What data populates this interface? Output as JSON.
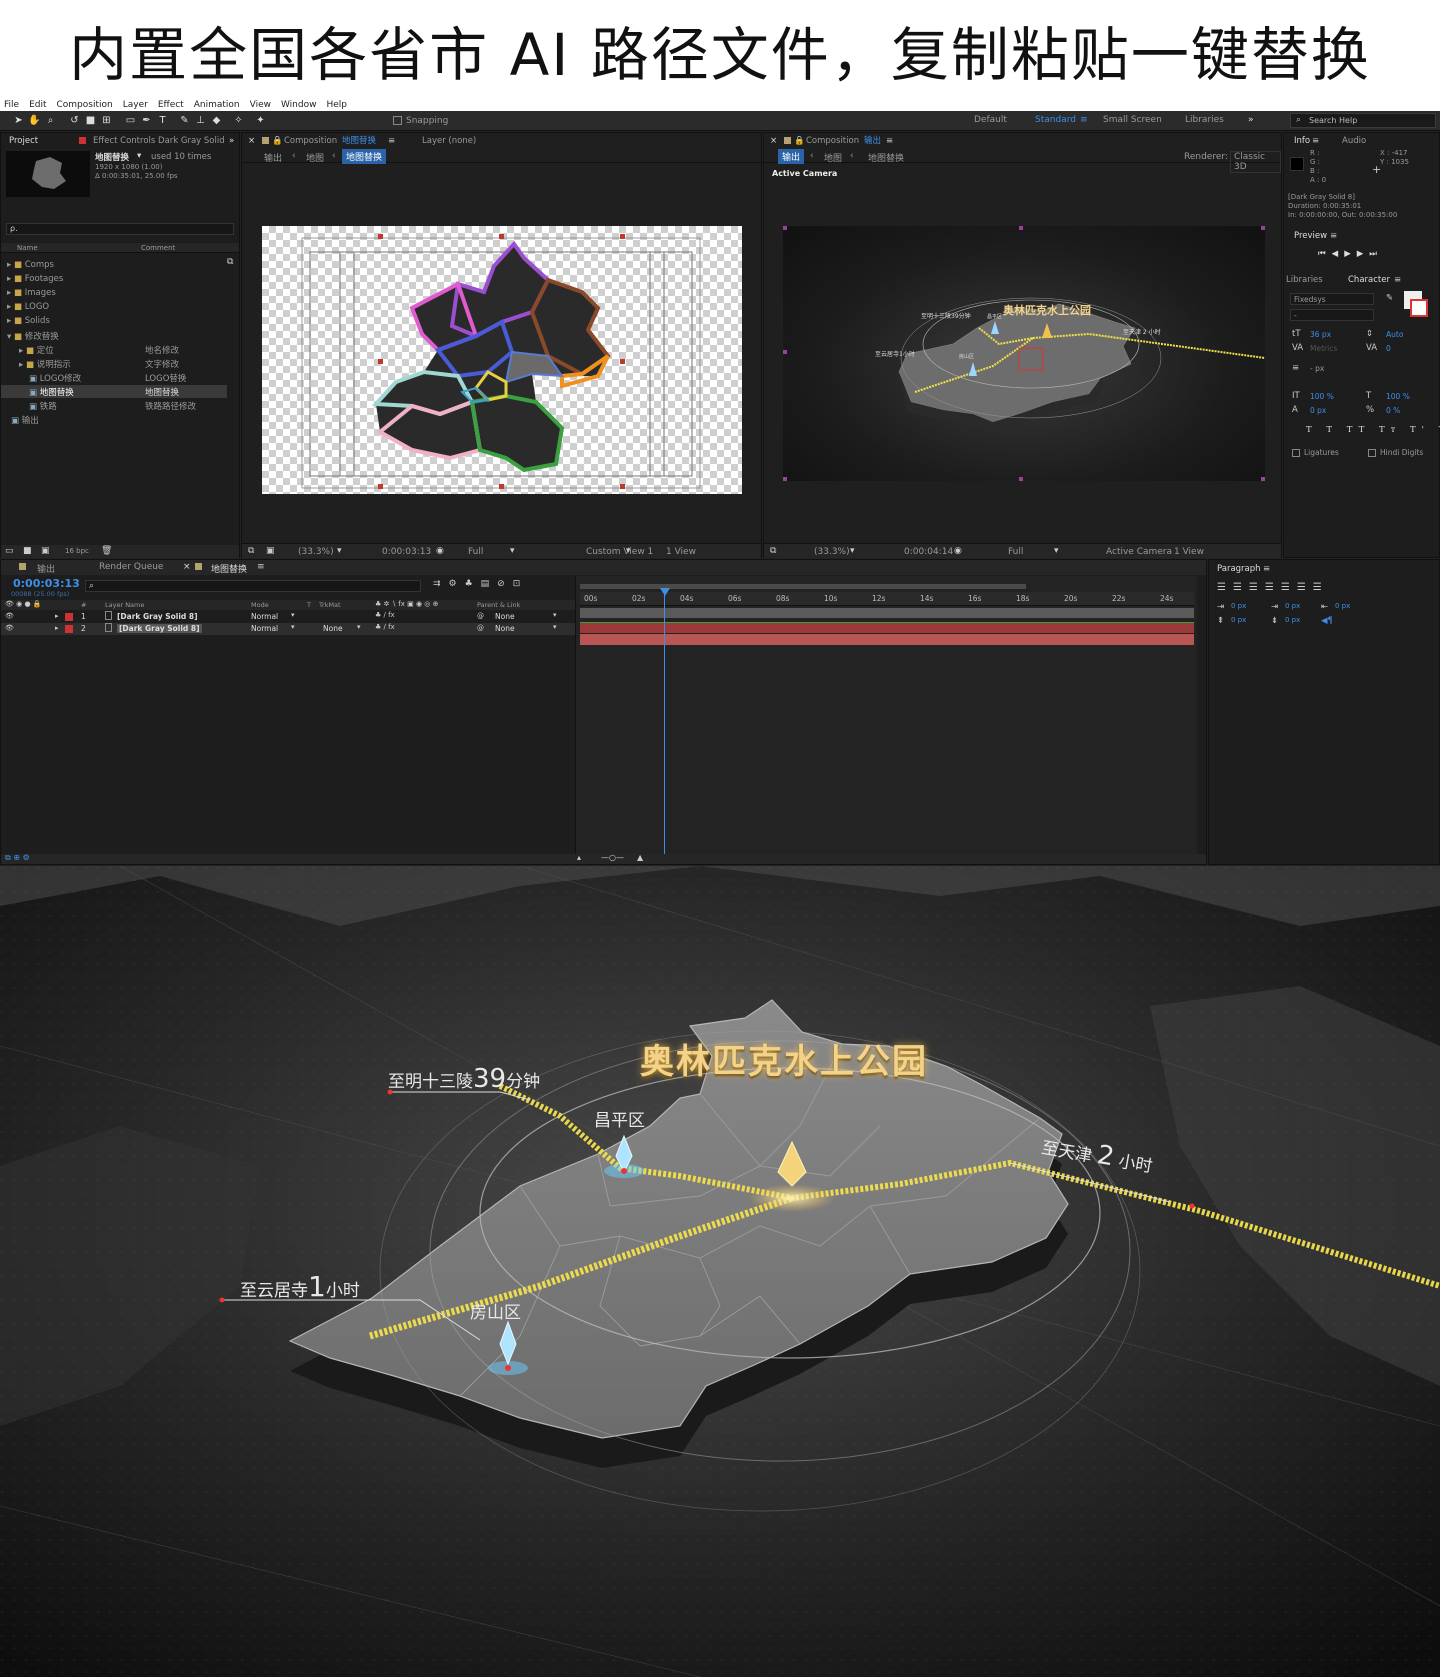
{
  "headline": "内置全国各省市 AI 路径文件，复制粘贴一键替换",
  "menu": [
    "File",
    "Edit",
    "Composition",
    "Layer",
    "Effect",
    "Animation",
    "View",
    "Window",
    "Help"
  ],
  "toolbar": {
    "snapping": "Snapping",
    "workspaces": [
      "Default",
      "Standard",
      "Small Screen",
      "Libraries"
    ],
    "active_workspace": "Standard",
    "search": "Search Help"
  },
  "project": {
    "tab": "Project",
    "effect_tab": "Effect Controls Dark Gray Solid",
    "item_name": "地图替换",
    "used": "used 10 times",
    "item_size": "1920 x 1080 (1.00)",
    "item_duration": "Δ 0:00:35:01, 25.00 fps",
    "search": "ρ.",
    "col_name": "Name",
    "col_comment": "Comment",
    "items": [
      {
        "name": "Comps",
        "comment": ""
      },
      {
        "name": "Footages",
        "comment": ""
      },
      {
        "name": "Images",
        "comment": ""
      },
      {
        "name": "LOGO",
        "comment": ""
      },
      {
        "name": "Solids",
        "comment": ""
      },
      {
        "name": "修改替换",
        "comment": ""
      },
      {
        "name": "定位",
        "comment": "地名修改"
      },
      {
        "name": "说明指示",
        "comment": "文字修改"
      },
      {
        "name": "LOGO修改",
        "comment": "LOGO替换"
      },
      {
        "name": "地图替换",
        "comment": "地图替换"
      },
      {
        "name": "铁路",
        "comment": "铁路路径修改"
      },
      {
        "name": "输出",
        "comment": ""
      }
    ],
    "bpc": "16 bpc"
  },
  "comp1": {
    "tab": "Composition",
    "tab_name": "地图替换",
    "layer": "Layer (none)",
    "crumbs": [
      "输出",
      "地图",
      "地图替换"
    ],
    "zoom": "(33.3%)",
    "time": "0:00:03:13",
    "quality": "Full",
    "view": "Custom View 1",
    "views": "1 View"
  },
  "comp2": {
    "tab": "Composition",
    "tab_name": "输出",
    "crumbs": [
      "输出",
      "地图",
      "地图替换"
    ],
    "renderer_label": "Renderer:",
    "renderer": "Classic 3D",
    "camera": "Active Camera",
    "zoom": "(33.3%)",
    "time": "0:00:04:14",
    "quality": "Full",
    "view": "Active Camera",
    "views": "1 View",
    "mini_title": "奥林匹克水上公园",
    "mini_labels": [
      "至明十三陵39分钟",
      "至云居寺1小时",
      "至天津 2 小时",
      "昌平区",
      "房山区"
    ]
  },
  "info": {
    "tab": "Info",
    "audio": "Audio",
    "rgba": [
      "R :",
      "G :",
      "B :",
      "A : 0"
    ],
    "x": "X : -417",
    "y": "Y : 1035",
    "layer": "[Dark Gray Solid 8]",
    "duration": "Duration: 0:00:35:01",
    "inout": "In: 0:00:00:00, Out: 0:00:35:00"
  },
  "preview": {
    "tab": "Preview"
  },
  "character": {
    "tab_lib": "Libraries",
    "tab": "Character",
    "font": "Fixedsys",
    "style": "-",
    "size": "36 px",
    "leading": "Auto",
    "kerning": "Metrics",
    "tracking": "0",
    "stroke": "- px",
    "vscale": "100 %",
    "hscale": "100 %",
    "baseline": "0 px",
    "tsume": "0 %",
    "ligatures": "Ligatures",
    "hindi": "Hindi Digits"
  },
  "paragraph": {
    "tab": "Paragraph",
    "values": [
      "0 px",
      "0 px",
      "0 px",
      "0 px",
      "0 px"
    ]
  },
  "timeline": {
    "tabs": [
      "输出",
      "Render Queue",
      "地图替换"
    ],
    "time": "0:00:03:13",
    "frames": "00088 (25.00 fps)",
    "cols": [
      "Layer Name",
      "Mode",
      "T",
      "TrkMat",
      "Parent & Link"
    ],
    "layers": [
      {
        "num": "1",
        "name": "[Dark Gray Solid 8]",
        "mode": "Normal",
        "trkmat": "",
        "parent": "None"
      },
      {
        "num": "2",
        "name": "[Dark Gray Solid 8]",
        "mode": "Normal",
        "trkmat": "None",
        "parent": "None"
      }
    ],
    "ruler": [
      "00s",
      "02s",
      "04s",
      "06s",
      "08s",
      "10s",
      "12s",
      "14s",
      "16s",
      "18s",
      "20s",
      "22s",
      "24s"
    ]
  },
  "render": {
    "title": "奥林匹克水上公园",
    "routes": [
      {
        "prefix": "至明十三陵",
        "num": "39",
        "suffix": "分钟"
      },
      {
        "prefix": "至云居寺",
        "num": "1",
        "suffix": "小时"
      },
      {
        "prefix": "至天津",
        "num": "2",
        "suffix": "小时"
      }
    ],
    "districts": [
      "昌平区",
      "房山区"
    ]
  },
  "colors": {
    "ae_bg": "#232323",
    "accent": "#3d8fe8",
    "gold": "#f3d38a",
    "rail": "#f2e04a"
  }
}
